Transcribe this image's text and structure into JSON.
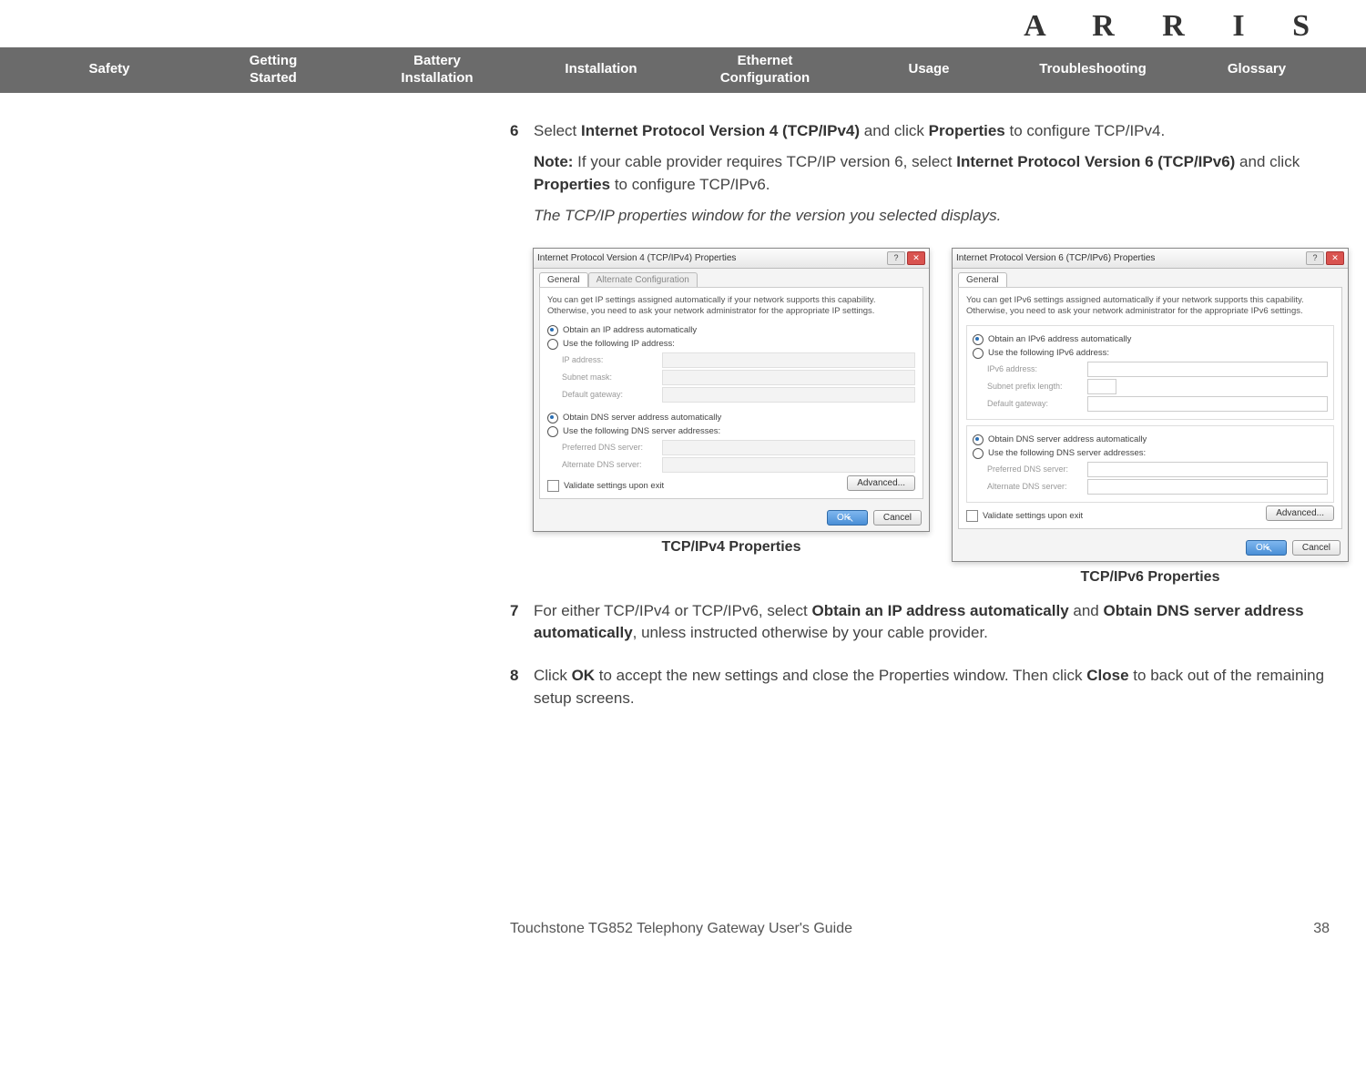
{
  "brand": "A R R I S",
  "nav": {
    "items": [
      "Safety",
      "Getting\nStarted",
      "Battery\nInstallation",
      "Installation",
      "Ethernet\nConfiguration",
      "Usage",
      "Troubleshooting",
      "Glossary"
    ]
  },
  "steps": {
    "six": {
      "num": "6",
      "p1_a": "Select ",
      "p1_b": "Internet Protocol Version 4 (TCP/IPv4)",
      "p1_c": " and click ",
      "p1_d": "Properties",
      "p1_e": " to configure TCP/IPv4.",
      "note_label": "Note:",
      "note_a": " If your cable provider requires TCP/IP version 6, select ",
      "note_b": "Internet Protocol Version 6 (TCP/IPv6)",
      "note_c": " and click ",
      "note_d": "Properties",
      "note_e": " to configure TCP/IPv6.",
      "italic": "The TCP/IP properties window for the version you selected displays."
    },
    "seven": {
      "num": "7",
      "a": "For either TCP/IPv4 or TCP/IPv6, select ",
      "b": "Obtain an IP address automatically",
      "c": " and ",
      "d": "Obtain DNS server address automatically",
      "e": ", unless instructed otherwise by your cable provider."
    },
    "eight": {
      "num": "8",
      "a": "Click ",
      "b": "OK",
      "c": " to accept the new settings and close the Properties window. Then click ",
      "d": "Close",
      "e": " to back out of the remaining setup screens."
    }
  },
  "dlg4": {
    "title": "Internet Protocol Version 4 (TCP/IPv4) Properties",
    "tab1": "General",
    "tab2": "Alternate Configuration",
    "desc": "You can get IP settings assigned automatically if your network supports this capability. Otherwise, you need to ask your network administrator for the appropriate IP settings.",
    "r1": "Obtain an IP address automatically",
    "r2": "Use the following IP address:",
    "f1": "IP address:",
    "f2": "Subnet mask:",
    "f3": "Default gateway:",
    "r3": "Obtain DNS server address automatically",
    "r4": "Use the following DNS server addresses:",
    "f4": "Preferred DNS server:",
    "f5": "Alternate DNS server:",
    "chk": "Validate settings upon exit",
    "adv": "Advanced...",
    "ok": "OK",
    "cancel": "Cancel",
    "caption": "TCP/IPv4 Properties"
  },
  "dlg6": {
    "title": "Internet Protocol Version 6 (TCP/IPv6) Properties",
    "tab1": "General",
    "desc": "You can get IPv6 settings assigned automatically if your network supports this capability. Otherwise, you need to ask your network administrator for the appropriate IPv6 settings.",
    "r1": "Obtain an IPv6 address automatically",
    "r2": "Use the following IPv6 address:",
    "f1": "IPv6 address:",
    "f2": "Subnet prefix length:",
    "f3": "Default gateway:",
    "r3": "Obtain DNS server address automatically",
    "r4": "Use the following DNS server addresses:",
    "f4": "Preferred DNS server:",
    "f5": "Alternate DNS server:",
    "chk": "Validate settings upon exit",
    "adv": "Advanced...",
    "ok": "OK",
    "cancel": "Cancel",
    "caption": "TCP/IPv6 Properties"
  },
  "footer": {
    "title": "Touchstone TG852 Telephony Gateway User's Guide",
    "page": "38"
  },
  "glyph": {
    "help": "?",
    "close": "✕"
  }
}
